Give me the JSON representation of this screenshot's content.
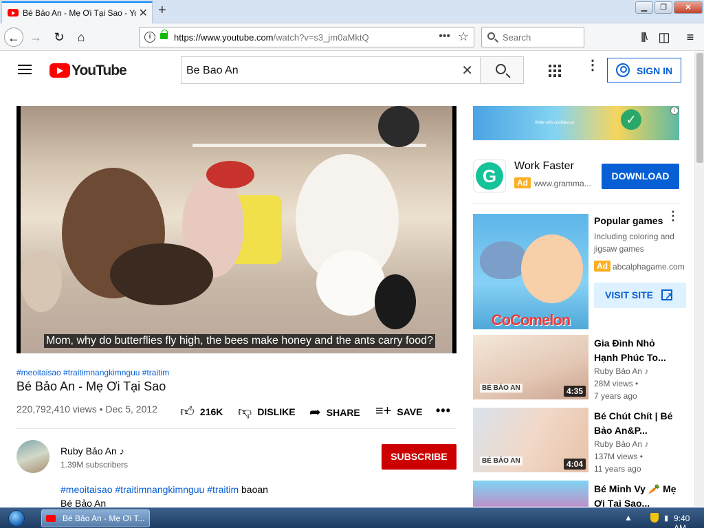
{
  "browser": {
    "tab_title": "Bé Bảo An - Mẹ Ơi Tại Sao - You",
    "tab_close": "✕",
    "new_tab": "+",
    "url_prefix": "https://www.youtube.com",
    "url_rest": "/watch?v=s3_jm0aMktQ",
    "search_placeholder": "Search",
    "page_actions": "•••",
    "bookmark_star": "☆"
  },
  "youtube": {
    "wordmark": "YouTube",
    "search_value": "Be Bao An",
    "clear": "✕",
    "sign_in": "SIGN IN"
  },
  "video": {
    "caption": "Mom, why do butterflies fly high, the bees make honey and the ants carry food?",
    "hashtags": "#meoitaisao #traitimnangkimnguu #traitim",
    "title": "Bé Bảo An - Mẹ Ơi Tại Sao",
    "views_date": "220,792,410 views • Dec 5, 2012",
    "likes": "216K",
    "dislike_label": "DISLIKE",
    "share_label": "SHARE",
    "save_label": "SAVE",
    "more": "•••"
  },
  "channel": {
    "name": "Ruby Bảo An",
    "note": "♪",
    "subscribers": "1.39M subscribers",
    "subscribe_label": "SUBSCRIBE",
    "desc_tags": "#meoitaisao #traitimnangkimnguu #traitim",
    "desc_plain": " baoan",
    "desc_line2": "Bé Bảo An"
  },
  "sidebar": {
    "banner_text": "Write with confidence",
    "ad1": {
      "title": "Work Faster",
      "badge": "Ad",
      "url": "www.gramma...",
      "cta": "DOWNLOAD"
    },
    "ad2": {
      "title": "Popular games",
      "desc": "Including coloring and jigsaw games",
      "badge": "Ad",
      "url": "abcalphagame.com",
      "cta": "VISIT SITE",
      "thumb_text": "CoComelon"
    },
    "recommendations": [
      {
        "title": "Gia Đình Nhỏ Hạnh Phúc To...",
        "channel": "Ruby Bảo An ♪",
        "views": "28M views •",
        "age": "7 years ago",
        "duration": "4:35",
        "tag": "BÉ BẢO AN"
      },
      {
        "title": "Bé Chút Chít | Bé Bảo An&P...",
        "channel": "Ruby Bảo An ♪",
        "views": "137M views •",
        "age": "11 years ago",
        "duration": "4:04",
        "tag": "BÉ BẢO AN"
      },
      {
        "title": "Bé Minh Vy 🥕 Mẹ Ơi Tại Sao...",
        "channel": "",
        "views": "",
        "age": "",
        "duration": "",
        "tag": ""
      }
    ]
  },
  "taskbar": {
    "task_label": "Bé Bảo An - Mẹ Ơi T...",
    "clock": "9:40 AM"
  },
  "colors": {
    "brand_red": "#ff0000",
    "link_blue": "#065fd4",
    "subscribe_red": "#cc0000",
    "ad_yellow": "#fbb024"
  }
}
